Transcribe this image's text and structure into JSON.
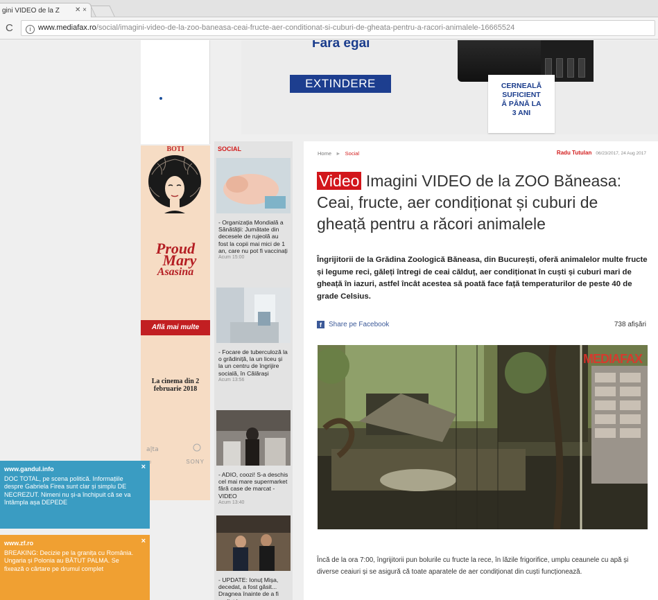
{
  "browser": {
    "tab_title": "gini VIDEO de la Z",
    "tab_close": "✕ ×",
    "url_host": "www.mediafax.ro",
    "url_path": "/social/imagini-video-de-la-zoo-baneasa-ceai-fructe-aer-conditionat-si-cuburi-de-gheata-pentru-a-racori-animalele-16665524"
  },
  "top_ad": {
    "headline": "Fără egal",
    "button_label": "EXTINDERE",
    "paper_lines": [
      "CERNEALĂ",
      "SUFICIENT",
      "Â PÂNĂ LA",
      "3 ANI"
    ]
  },
  "side_ad": {
    "top_label": "BOTI",
    "title_lines": [
      "Proud",
      "Mary"
    ],
    "subtitle": "Asasina",
    "button_label": "Află mai multe",
    "cinema_text": "La cinema din 2 februarie 2018",
    "logos": "sony"
  },
  "notices": [
    {
      "site": "www.gandul.info",
      "text": "DOC TOTAL, pe scena politică. Informațiile despre Gabriela Firea sunt clar și simplu DE NECREZUT. Nimeni nu și-a închipuit că se va întâmpla așa DEPEDE",
      "close": "×"
    },
    {
      "site": "www.zf.ro",
      "text": "BREAKING: Decizie pe la granița cu România. Ungaria și Polonia au BĂTUT PALMA. Se fixează o cârtare pe drumul complet",
      "close": "×"
    }
  ],
  "social": {
    "heading": "SOCIAL",
    "items": [
      {
        "title": "- Organizația Mondială a Sănătății: Jumătate din decesele de rujeolă au fost la copii mai mici de 1 an, care nu pot fi vaccinați",
        "time": "Acum 15:00"
      },
      {
        "title": "- Focare de tuberculoză la o grădiniță, la un liceu și la un centru de îngrijire socială, în Călărași",
        "time": "Acum 13:56"
      },
      {
        "title": "- ADIO, coozi! S-a deschis cel mai mare supermarket fără case de marcat - VIDEO",
        "time": "Acum 13:40"
      },
      {
        "title": "- UPDATE: Ionuț Mișa, decedat, a fost găsit... Dragnea înainte de a fi audiat la",
        "time": ""
      }
    ]
  },
  "article": {
    "crumb_home": "Home",
    "crumb_sep": "►",
    "crumb_section": "Social",
    "author": "Radu Tutulan",
    "date": "06/23/2017, 24 Aug 2017",
    "badge": "Video",
    "title": "Imagini VIDEO de la ZOO Băneasa: Ceai, fructe, aer condiționat și cuburi de gheață pentru a răcori animalele",
    "lead": "Îngrijitorii de la Grădina Zoologică Băneasa, din București, oferă animalelor multe fructe și legume reci, găleți întregi de ceai călduț, aer condiționat în cuști și cuburi mari de gheață în iazuri, astfel încât acestea să poată face față temperaturilor de peste 40 de grade Celsius.",
    "share_label": "Share pe Facebook",
    "views": "738 afișări",
    "watermark": "MEDIAFAX",
    "body": "Încă de la ora 7:00, îngrijitorii pun bolurile cu fructe la rece, în lăzile frigorifice, umplu ceaunele cu apă și diverse ceaiuri și se asigură că toate aparatele de aer condiționat din cuști funcționează."
  },
  "colors": {
    "accent_red": "#d2161b",
    "brand_blue": "#1d3e8f",
    "facebook": "#3b5998",
    "notice_blue": "#3a9cc2",
    "notice_orange": "#f0a032"
  }
}
